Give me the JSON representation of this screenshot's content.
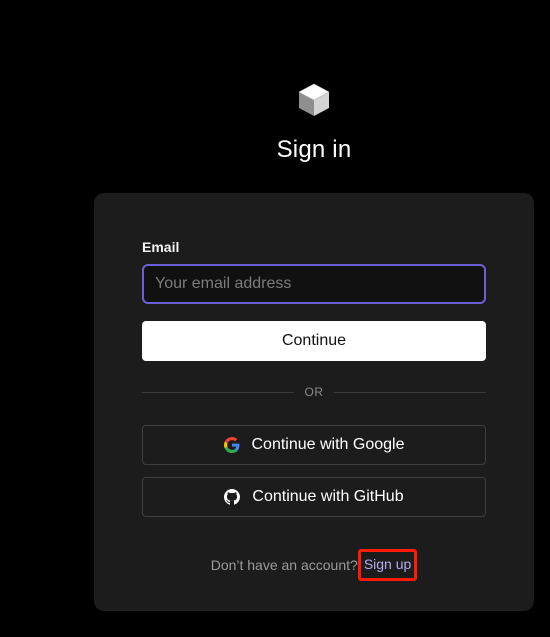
{
  "title": "Sign in",
  "logo": {
    "icon": "cube-logo-icon"
  },
  "form": {
    "email_label": "Email",
    "email_placeholder": "Your email address",
    "email_value": "",
    "continue_label": "Continue",
    "divider_text": "OR",
    "google_label": "Continue with Google",
    "google_icon": "google-icon",
    "github_label": "Continue with GitHub",
    "github_icon": "github-icon"
  },
  "footer": {
    "prompt": "Don’t have an account?",
    "signup_label": "Sign up"
  },
  "colors": {
    "background": "#000000",
    "card": "#1c1c1c",
    "input_focus_border": "#6d5fd1",
    "link": "#b7aaf0",
    "highlight": "#ff1a00"
  }
}
